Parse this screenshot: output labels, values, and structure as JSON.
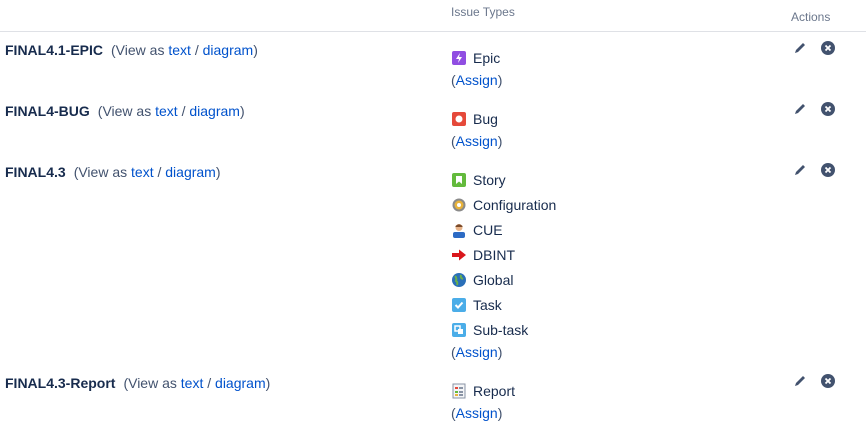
{
  "header": {
    "issue_types": "Issue Types",
    "actions": "Actions"
  },
  "common": {
    "view_as": "(View as",
    "text": "text",
    "sep": "/",
    "diagram": "diagram",
    "close_paren": ")",
    "assign_open": "(",
    "assign": "Assign",
    "assign_close": ")"
  },
  "schemes": [
    {
      "name": "FINAL4.1-EPIC",
      "types": [
        {
          "label": "Epic",
          "icon": "epic-icon"
        }
      ]
    },
    {
      "name": "FINAL4-BUG",
      "types": [
        {
          "label": "Bug",
          "icon": "bug-icon"
        }
      ]
    },
    {
      "name": "FINAL4.3",
      "types": [
        {
          "label": "Story",
          "icon": "story-icon"
        },
        {
          "label": "Configuration",
          "icon": "configuration-icon"
        },
        {
          "label": "CUE",
          "icon": "cue-icon"
        },
        {
          "label": "DBINT",
          "icon": "dbint-icon"
        },
        {
          "label": "Global",
          "icon": "global-icon"
        },
        {
          "label": "Task",
          "icon": "task-icon"
        },
        {
          "label": "Sub-task",
          "icon": "subtask-icon"
        }
      ]
    },
    {
      "name": "FINAL4.3-Report",
      "types": [
        {
          "label": "Report",
          "icon": "report-icon"
        }
      ]
    }
  ]
}
